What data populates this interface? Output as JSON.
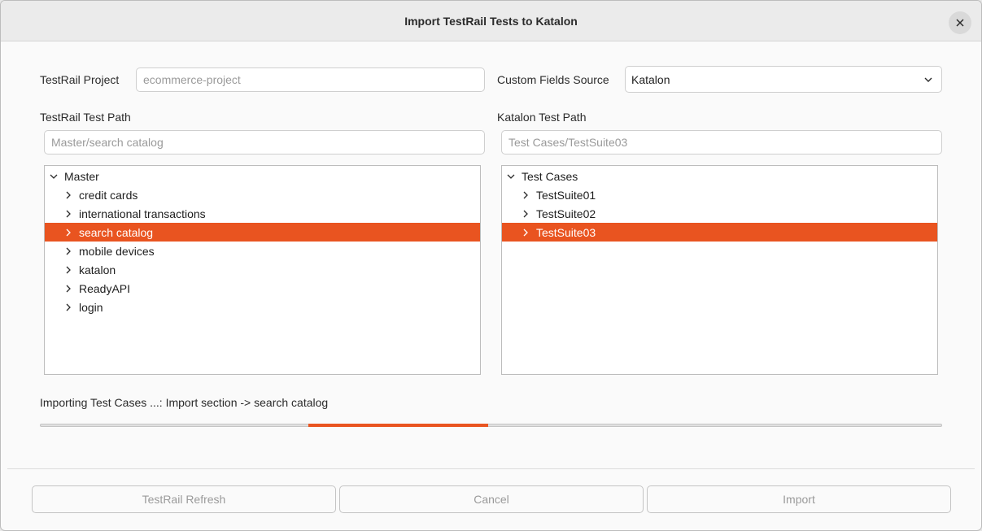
{
  "dialog": {
    "title": "Import TestRail Tests to Katalon",
    "close_icon": "close-icon"
  },
  "form": {
    "project_label": "TestRail Project",
    "project_placeholder": "ecommerce-project",
    "custom_fields_label": "Custom Fields Source",
    "custom_fields_value": "Katalon",
    "testrail_path_label": "TestRail Test Path",
    "testrail_path_placeholder": "Master/search catalog",
    "katalon_path_label": "Katalon Test Path",
    "katalon_path_placeholder": "Test Cases/TestSuite03"
  },
  "testrail_tree": {
    "root": "Master",
    "items": [
      {
        "label": "credit cards",
        "selected": false
      },
      {
        "label": "international transactions",
        "selected": false
      },
      {
        "label": "search catalog",
        "selected": true
      },
      {
        "label": "mobile devices",
        "selected": false
      },
      {
        "label": "katalon",
        "selected": false
      },
      {
        "label": "ReadyAPI",
        "selected": false
      },
      {
        "label": "login",
        "selected": false
      }
    ]
  },
  "katalon_tree": {
    "root": "Test Cases",
    "items": [
      {
        "label": "TestSuite01",
        "selected": false
      },
      {
        "label": "TestSuite02",
        "selected": false
      },
      {
        "label": "TestSuite03",
        "selected": true
      }
    ]
  },
  "status": {
    "text": "Importing Test Cases ...: Import section -> search catalog"
  },
  "progress": {
    "start_fraction": 0.297,
    "end_fraction": 0.497,
    "color": "#e95420"
  },
  "buttons": {
    "refresh_label": "TestRail Refresh",
    "cancel_label": "Cancel",
    "import_label": "Import"
  },
  "colors": {
    "accent": "#e95420"
  }
}
